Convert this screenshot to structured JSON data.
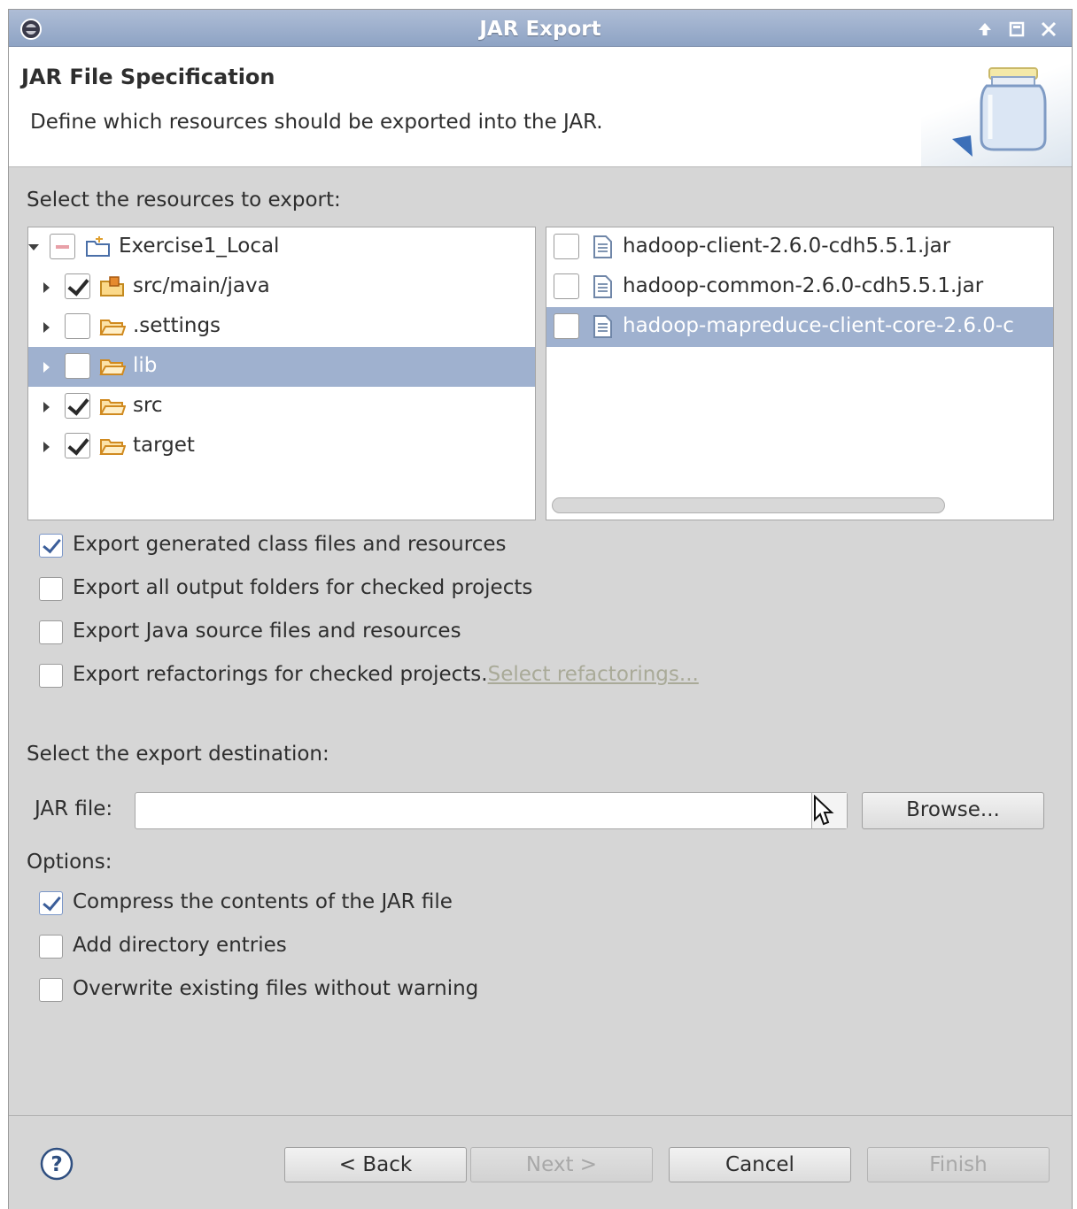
{
  "window": {
    "title": "JAR Export"
  },
  "header": {
    "title": "JAR File Specification",
    "description": "Define which resources should be exported into the JAR."
  },
  "resources": {
    "label_pre": "Select the resources to export:",
    "tree": [
      {
        "label": "Exercise1_Local",
        "state": "grayed",
        "expanded": true
      },
      {
        "label": "src/main/java",
        "state": "checked"
      },
      {
        "label": ".settings",
        "state": "unchecked"
      },
      {
        "label": "lib",
        "state": "unchecked",
        "selected": true
      },
      {
        "label": "src",
        "state": "checked"
      },
      {
        "label": "target",
        "state": "checked"
      }
    ],
    "files": [
      {
        "label": "hadoop-client-2.6.0-cdh5.5.1.jar",
        "state": "unchecked"
      },
      {
        "label": "hadoop-common-2.6.0-cdh5.5.1.jar",
        "state": "unchecked"
      },
      {
        "label": "hadoop-mapreduce-client-core-2.6.0-c",
        "state": "unchecked",
        "selected": true
      }
    ]
  },
  "export_options": {
    "class_files": {
      "label": "Export generated class files and resources",
      "checked": true
    },
    "output_folders": {
      "label": "Export all output folders for checked projects",
      "checked": false
    },
    "java_source": {
      "label": "Export Java source files and resources",
      "checked": false
    },
    "refactorings": {
      "label": "Export refactorings for checked projects.",
      "link": "Select refactorings...",
      "checked": false
    }
  },
  "destination": {
    "label": "Select the export destination:",
    "jar_file_label": "JAR file:",
    "jar_file_value": "",
    "browse_label": "Browse..."
  },
  "options": {
    "label": "Options:",
    "compress": {
      "label": "Compress the contents of the JAR file",
      "checked": true
    },
    "directory_entries": {
      "label": "Add directory entries",
      "checked": false
    },
    "overwrite": {
      "label": "Overwrite existing files without warning",
      "checked": false
    }
  },
  "buttons": {
    "back": "< Back",
    "next": "Next >",
    "cancel": "Cancel",
    "finish": "Finish"
  },
  "icons": {
    "app": "eclipse-icon",
    "help": "help-icon",
    "project": "project-folder-icon",
    "package": "package-folder-icon",
    "folder": "folder-icon",
    "file": "file-icon",
    "jar_banner": "jar-icon"
  }
}
